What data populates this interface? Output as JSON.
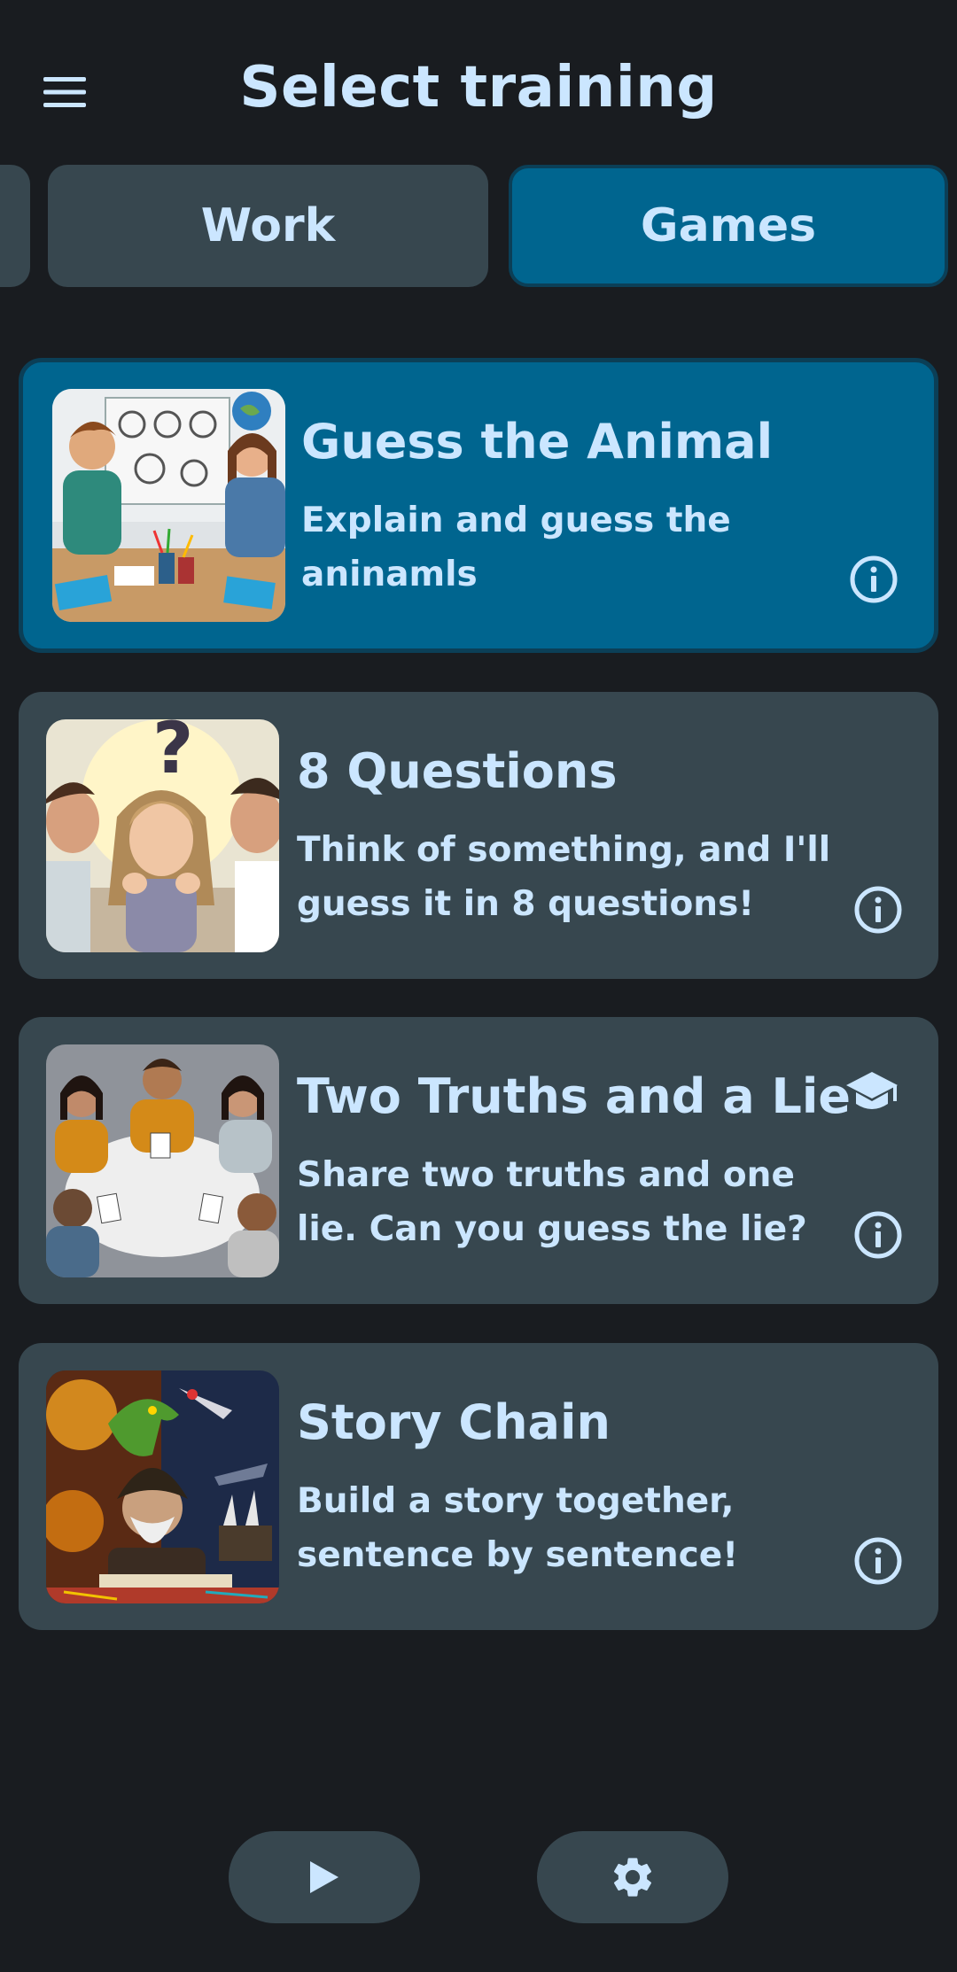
{
  "header": {
    "title": "Select training",
    "menu_icon": "menu-icon"
  },
  "tabs": [
    {
      "label": ""
    },
    {
      "label": "Work"
    },
    {
      "label": "Games",
      "selected": true
    }
  ],
  "cards": [
    {
      "title": "Guess the Animal",
      "description": "Explain and guess the aninamls",
      "image": "kids-drawing-animals-illustration",
      "selected": true,
      "info_icon": "info-icon"
    },
    {
      "title": "8 Questions",
      "description": "Think of something, and I'll guess it in 8 questions!",
      "image": "girl-with-question-mark-illustration",
      "selected": false,
      "info_icon": "info-icon"
    },
    {
      "title": "Two Truths and a Lie",
      "description": "Share two truths and one lie. Can you guess the lie?",
      "image": "friends-with-truth-lie-cards-illustration",
      "selected": false,
      "badge_icon": "graduation-cap-icon",
      "info_icon": "info-icon"
    },
    {
      "title": "Story Chain",
      "description": "Build a story together, sentence by sentence!",
      "image": "fantasy-storyteller-dragon-illustration",
      "selected": false,
      "info_icon": "info-icon"
    }
  ],
  "bottom_bar": {
    "play_icon": "play-icon",
    "settings_icon": "gear-icon"
  },
  "colors": {
    "background": "#191c20",
    "surface": "#37474f",
    "accent": "#00658f",
    "text": "#cbe6ff"
  }
}
